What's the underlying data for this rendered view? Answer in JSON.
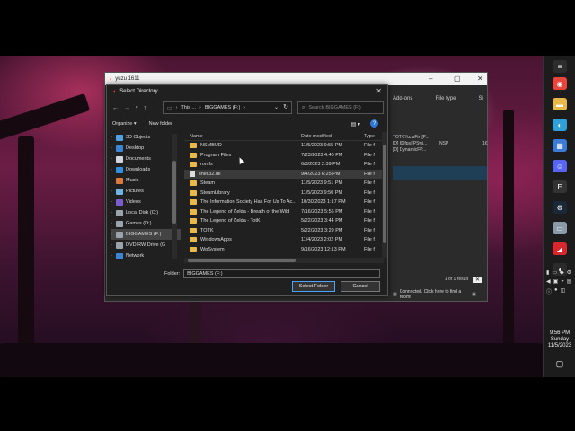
{
  "yuzu": {
    "title": "yuzu 1611",
    "columns": [
      "Add-ons",
      "File type",
      "Si"
    ],
    "addons_lines": [
      "TOTKYuzuFix [P...",
      "[D] 60fps [PSwi...",
      "[D] DynamicFP..."
    ],
    "file_type": "NSP",
    "size_fragment": "1€",
    "results": "1 of 1 result",
    "status": "Connected. Click here to find a room!"
  },
  "dialog": {
    "title": "Select Directory",
    "address_parts": [
      "This ...",
      "BIGGAMES (F:)"
    ],
    "search_placeholder": "Search BIGGAMES (F:)",
    "organize": "Organize",
    "new_folder": "New folder",
    "nav_items": [
      {
        "label": "3D Objects",
        "icon": "3d-objects-icon",
        "color": "#4fa3e0"
      },
      {
        "label": "Desktop",
        "icon": "desktop-icon",
        "color": "#3a86d4"
      },
      {
        "label": "Documents",
        "icon": "documents-icon",
        "color": "#cfd6de"
      },
      {
        "label": "Downloads",
        "icon": "downloads-icon",
        "color": "#2f8fe0"
      },
      {
        "label": "Music",
        "icon": "music-icon",
        "color": "#e07a3a"
      },
      {
        "label": "Pictures",
        "icon": "pictures-icon",
        "color": "#6fb3e8"
      },
      {
        "label": "Videos",
        "icon": "videos-icon",
        "color": "#7b5bd0"
      },
      {
        "label": "Local Disk (C:)",
        "icon": "disk-icon",
        "color": "#9aa4ad"
      },
      {
        "label": "Games (D:)",
        "icon": "disk-icon",
        "color": "#9aa4ad"
      },
      {
        "label": "BIGGAMES (F:)",
        "icon": "disk-icon",
        "color": "#9aa4ad"
      },
      {
        "label": "DVD RW Drive (G",
        "icon": "dvd-icon",
        "color": "#9aa4ad"
      },
      {
        "label": "Network",
        "icon": "network-icon",
        "color": "#3a86d4"
      }
    ],
    "headers": {
      "name": "Name",
      "date": "Date modified",
      "type": "Type"
    },
    "files": [
      {
        "name": "NSMBUD",
        "date": "11/5/2023 9:55 PM",
        "type": "File f",
        "kind": "folder"
      },
      {
        "name": "Program Files",
        "date": "7/23/2023 4:40 PM",
        "type": "File f",
        "kind": "folder"
      },
      {
        "name": "romfs",
        "date": "6/3/2023 2:39 PM",
        "type": "File f",
        "kind": "folder"
      },
      {
        "name": "shell32.dll",
        "date": "9/4/2023 6:25 PM",
        "type": "File f",
        "kind": "file"
      },
      {
        "name": "Steam",
        "date": "11/5/2023 9:51 PM",
        "type": "File f",
        "kind": "folder"
      },
      {
        "name": "SteamLibrary",
        "date": "11/5/2023 9:50 PM",
        "type": "File f",
        "kind": "folder"
      },
      {
        "name": "The Information Society Has For Us To Ac...",
        "date": "10/30/2023 1:17 PM",
        "type": "File f",
        "kind": "folder"
      },
      {
        "name": "The Legend of Zelda - Breath of the Wild",
        "date": "7/16/2023 5:56 PM",
        "type": "File f",
        "kind": "folder"
      },
      {
        "name": "The Legend of Zelda - TotK",
        "date": "5/22/2023 3:44 PM",
        "type": "File f",
        "kind": "folder"
      },
      {
        "name": "TOTK",
        "date": "5/22/2023 3:29 PM",
        "type": "File f",
        "kind": "folder"
      },
      {
        "name": "WindowsApps",
        "date": "11/4/2023 2:02 PM",
        "type": "File f",
        "kind": "folder"
      },
      {
        "name": "WpSystem",
        "date": "9/16/2023 12:13 PM",
        "type": "File f",
        "kind": "folder"
      }
    ],
    "folder_label": "Folder:",
    "folder_value": "BIGGAMES (F:)",
    "select_button": "Select Folder",
    "cancel_button": "Cancel"
  },
  "clock": {
    "time": "9:56 PM",
    "day": "Sunday",
    "date": "11/5/2023"
  },
  "taskbar_icons": [
    {
      "name": "chrome-icon",
      "color": "#e8453c",
      "glyph": "◉"
    },
    {
      "name": "file-explorer-icon",
      "color": "#e8b84a",
      "glyph": "▬"
    },
    {
      "name": "edge-icon",
      "color": "#2fa0d8",
      "glyph": "◐"
    },
    {
      "name": "store-icon",
      "color": "#3b7bd6",
      "glyph": "▦"
    },
    {
      "name": "discord-icon",
      "color": "#5865f2",
      "glyph": "☺"
    },
    {
      "name": "epic-games-icon",
      "color": "#333333",
      "glyph": "E"
    },
    {
      "name": "steam-icon",
      "color": "#1b2838",
      "glyph": "⚙"
    },
    {
      "name": "drive-icon",
      "color": "#8a9aa8",
      "glyph": "▭"
    },
    {
      "name": "amd-icon",
      "color": "#d8282d",
      "glyph": "◢"
    },
    {
      "name": "yuzu-icon",
      "color": "#2b2b2b",
      "glyph": "◖"
    }
  ]
}
